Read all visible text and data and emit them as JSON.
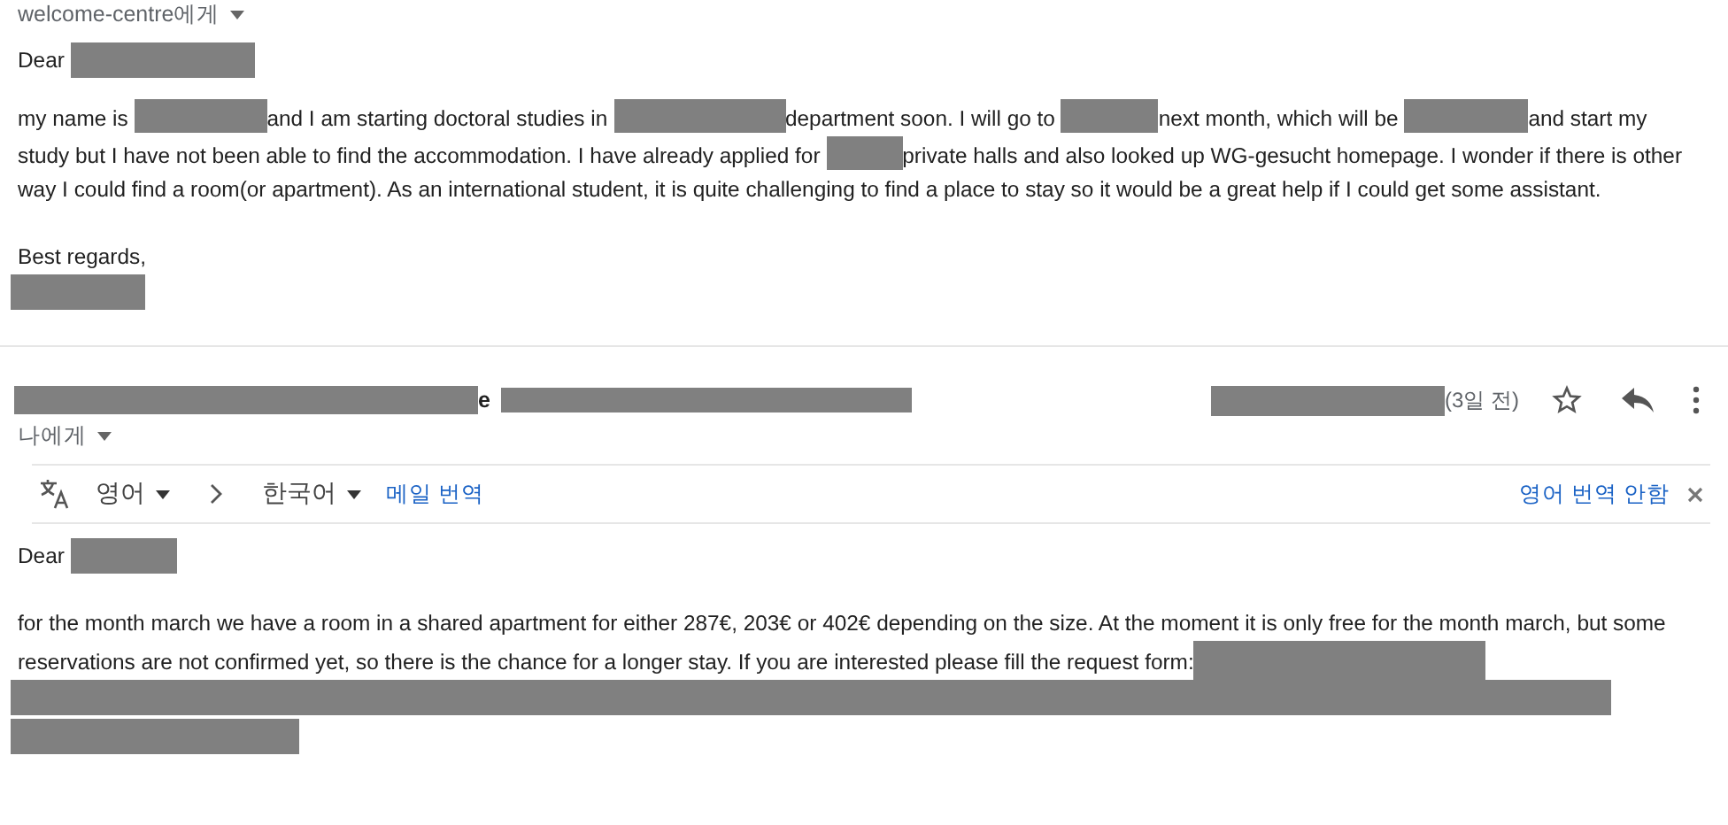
{
  "first_message": {
    "recipient": "welcome-centre에게",
    "greeting": [
      {
        "kind": "text",
        "text": "Dear"
      },
      {
        "kind": "redacted"
      }
    ],
    "body": [
      {
        "kind": "text",
        "text": "my name is"
      },
      {
        "kind": "redacted"
      },
      {
        "kind": "text",
        "text": "and I am starting doctoral studies in"
      },
      {
        "kind": "redacted"
      },
      {
        "kind": "text",
        "text": "department soon. I will go to"
      },
      {
        "kind": "redacted"
      },
      {
        "kind": "text",
        "text": "next month, which will be"
      },
      {
        "kind": "redacted"
      },
      {
        "kind": "text",
        "text": "and start my study but I have not been able to find the accommodation. I have already applied for"
      },
      {
        "kind": "redacted"
      },
      {
        "kind": "text",
        "text": "private halls and also looked up WG-gesucht homepage. I wonder if there is other way I could find a room(or apartment). As an international student, it is quite challenging to find a place to stay so it would be a great help if I could get some assistant."
      }
    ],
    "closing": "Best regards,"
  },
  "second_message": {
    "sender_tail": "e",
    "time": "(3일 전)",
    "recipient": "나에게",
    "translate_bar": {
      "source": "영어",
      "target": "한국어",
      "translate_link": "메일 번역",
      "never_link": "영어 번역 안함"
    },
    "greeting": [
      {
        "kind": "text",
        "text": "Dear"
      },
      {
        "kind": "redacted"
      }
    ],
    "body": [
      {
        "kind": "text",
        "text": "for the month march we have a room in a shared apartment for either 287€, 203€ or 402€ depending on the size. At the moment it is only free for the month march, but some reservations are not confirmed yet, so there is the chance for a longer stay. If you are interested please fill the request form:"
      },
      {
        "kind": "redacted"
      },
      {
        "kind": "redacted"
      },
      {
        "kind": "redacted"
      }
    ]
  }
}
